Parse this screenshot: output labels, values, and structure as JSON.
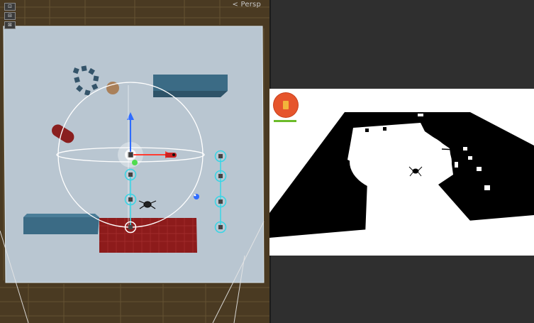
{
  "scene_view": {
    "camera_mode_label": "< Persp",
    "toolbar": {
      "buttons": [
        {
          "icon": "pivot-icon"
        },
        {
          "icon": "grid-icon"
        },
        {
          "icon": "snap-icon"
        }
      ]
    }
  },
  "game_view": {
    "player_icon": "door-icon",
    "health_fraction": 1.0
  },
  "colors": {
    "scene_background": "#4a3a22",
    "ground_plane": "#b9c6d1",
    "obstacle_blue": "#3b6b85",
    "obstacle_red": "#8d1b1b",
    "capsule_red": "#8a1f1f",
    "gizmo_cyan": "#38d6e6",
    "gizmo_blue": "#2f6cff",
    "gizmo_red": "#ff3b30",
    "gizmo_green": "#4fdc4f",
    "game_black": "#000000",
    "game_white": "#ffffff",
    "avatar_orange": "#e6552c",
    "health_green": "#6cbb2a"
  }
}
